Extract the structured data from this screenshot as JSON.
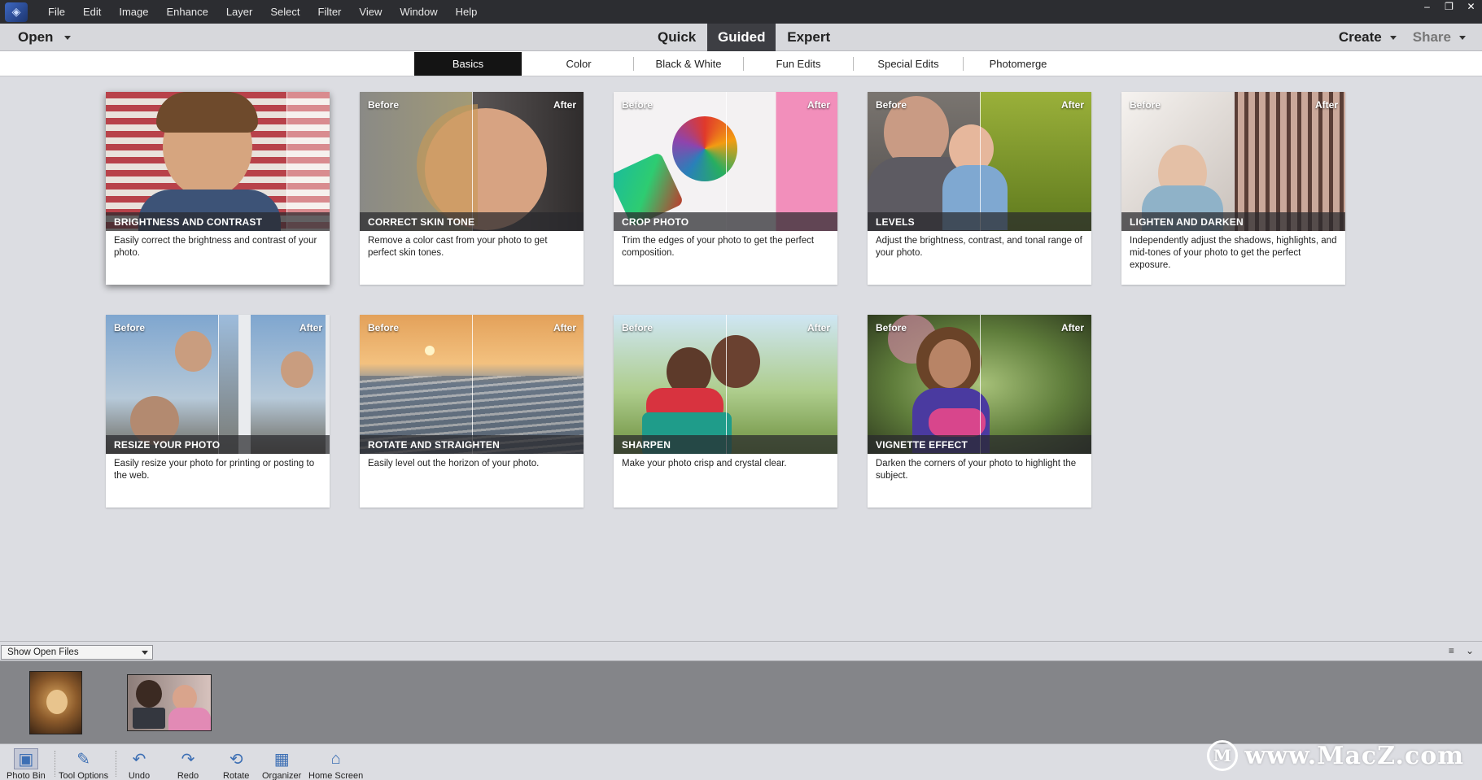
{
  "menu": [
    "File",
    "Edit",
    "Image",
    "Enhance",
    "Layer",
    "Select",
    "Filter",
    "View",
    "Window",
    "Help"
  ],
  "window_controls": [
    "–",
    "❐",
    "✕"
  ],
  "modebar": {
    "open_label": "Open",
    "modes": [
      "Quick",
      "Guided",
      "Expert"
    ],
    "active_mode": "Guided",
    "create_label": "Create",
    "share_label": "Share"
  },
  "tabs": [
    "Basics",
    "Color",
    "Black & White",
    "Fun Edits",
    "Special Edits",
    "Photomerge"
  ],
  "active_tab": "Basics",
  "before_label": "Before",
  "after_label": "After",
  "cards": [
    {
      "title": "Brightness and Contrast",
      "desc": "Easily correct the brightness and contrast of your photo.",
      "show_labels": false
    },
    {
      "title": "Correct Skin Tone",
      "desc": "Remove a color cast from your photo to get perfect skin tones.",
      "show_labels": true
    },
    {
      "title": "Crop Photo",
      "desc": "Trim the edges of your photo to get the perfect composition.",
      "show_labels": true
    },
    {
      "title": "Levels",
      "desc": "Adjust the brightness, contrast, and tonal range of your photo.",
      "show_labels": true
    },
    {
      "title": "Lighten and Darken",
      "desc": "Independently adjust the shadows, highlights, and mid-tones of your photo to get the perfect exposure.",
      "show_labels": true
    },
    {
      "title": "Resize Your Photo",
      "desc": "Easily resize your photo for printing or posting to the web.",
      "show_labels": true
    },
    {
      "title": "Rotate and Straighten",
      "desc": "Easily level out the horizon of your photo.",
      "show_labels": true
    },
    {
      "title": "Sharpen",
      "desc": "Make your photo crisp and crystal clear.",
      "show_labels": true
    },
    {
      "title": "Vignette Effect",
      "desc": "Darken the corners of your photo to highlight the subject.",
      "show_labels": true
    }
  ],
  "bin": {
    "dropdown": "Show Open Files",
    "icons": [
      "≡",
      "⌄"
    ]
  },
  "taskbar": [
    {
      "label": "Photo Bin",
      "icon": "photo-bin-icon",
      "glyph": "▣"
    },
    {
      "label": "Tool Options",
      "icon": "tool-options-icon",
      "glyph": "✎"
    },
    {
      "label": "Undo",
      "icon": "undo-icon",
      "glyph": "↶"
    },
    {
      "label": "Redo",
      "icon": "redo-icon",
      "glyph": "↷"
    },
    {
      "label": "Rotate",
      "icon": "rotate-icon",
      "glyph": "⟲"
    },
    {
      "label": "Organizer",
      "icon": "organizer-icon",
      "glyph": "▦"
    },
    {
      "label": "Home Screen",
      "icon": "home-screen-icon",
      "glyph": "⌂"
    }
  ],
  "watermark": {
    "logo": "M",
    "text": "www.MacZ.com"
  },
  "colors": {
    "menubar": "#2c2d31",
    "active_mode": "#3d3e43",
    "active_tab": "#141414",
    "workspace": "#dcdde2"
  }
}
